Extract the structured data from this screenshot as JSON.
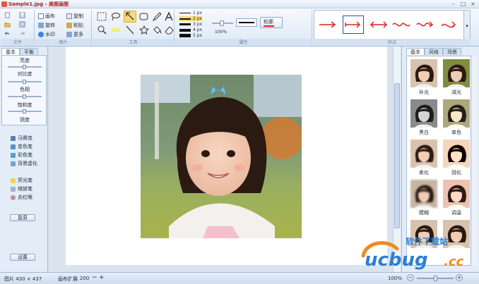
{
  "window": {
    "title": "Sample1.jpg - 美图画图",
    "buttons": [
      "–",
      "□",
      "×"
    ]
  },
  "ribbon": {
    "groups": [
      "文件",
      "图片",
      "工具",
      "属性",
      "样式"
    ],
    "image_buttons": [
      "画布",
      "旋转",
      "水印",
      "复制",
      "粘贴",
      "更多"
    ],
    "line_widths": [
      "1 px",
      "2 px",
      "3 px",
      "4 px",
      "5 px"
    ],
    "zoom": "100%",
    "fill_button": "轮廓",
    "colors": {
      "accent": "#2b4f9c",
      "selected": "#f8d978",
      "arrow_red": "#e02020"
    }
  },
  "left_panel": {
    "tabs": [
      "基本",
      "平衡"
    ],
    "adjustments": [
      "亮度",
      "对比度",
      "色相",
      "饱和度",
      "锐度"
    ],
    "levels": [
      0.5,
      0.5,
      0.5,
      0.5
    ],
    "pens": [
      "马赛克",
      "变色笔",
      "彩色笔",
      "背景虚化"
    ],
    "tools": [
      "荧光笔",
      "缩放笔",
      "去红眼"
    ],
    "reset_button": "复原",
    "settings_button": "设置"
  },
  "right_panel": {
    "tabs": [
      "基本",
      "风格",
      "场景"
    ],
    "effects": [
      "补光",
      "减光",
      "黑白",
      "单色",
      "柔化",
      "锐化",
      "模糊",
      "调温",
      "",
      ""
    ]
  },
  "status": {
    "image_size": "图片  430 × 437",
    "canvas_label": "画布扩展",
    "canvas_value": "200",
    "zoom": "100%"
  },
  "watermark": {
    "brand": "ucbug",
    "suffix": ".cc",
    "site": "软件下载站"
  }
}
